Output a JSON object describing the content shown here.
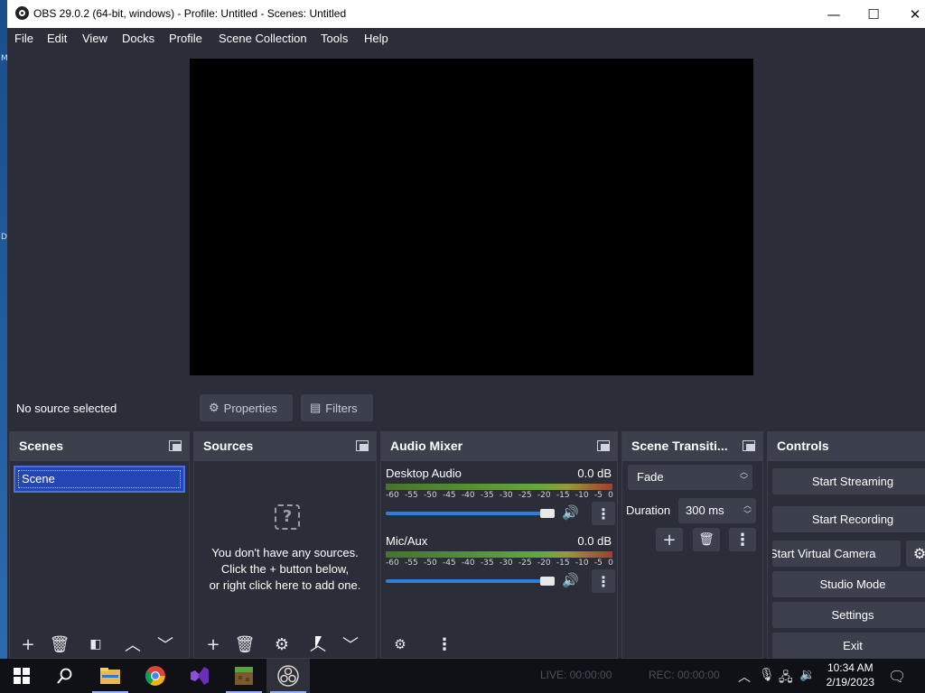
{
  "window": {
    "title": "OBS 29.0.2 (64-bit, windows) - Profile: Untitled - Scenes: Untitled",
    "controls": {
      "minimize": "—",
      "maximize": "☐",
      "close": "✕"
    }
  },
  "desktop_fragments": [
    "M",
    "D"
  ],
  "menu": [
    "File",
    "Edit",
    "View",
    "Docks",
    "Profile",
    "Scene Collection",
    "Tools",
    "Help"
  ],
  "source_toolbar": {
    "status": "No source selected",
    "properties_label": "Properties",
    "filters_label": "Filters"
  },
  "docks": {
    "scenes": {
      "title": "Scenes",
      "items": [
        "Scene"
      ],
      "selected": "Scene"
    },
    "sources": {
      "title": "Sources",
      "empty_line1": "You don't have any sources.",
      "empty_line2": "Click the + button below,",
      "empty_line3": "or right click here to add one."
    },
    "audio_mixer": {
      "title": "Audio Mixer",
      "scale": [
        "-60",
        "-55",
        "-50",
        "-45",
        "-40",
        "-35",
        "-30",
        "-25",
        "-20",
        "-15",
        "-10",
        "-5",
        "0"
      ],
      "channels": [
        {
          "name": "Desktop Audio",
          "db": "0.0 dB",
          "volume": 1.0
        },
        {
          "name": "Mic/Aux",
          "db": "0.0 dB",
          "volume": 1.0
        }
      ]
    },
    "transitions": {
      "title": "Scene Transiti...",
      "selected": "Fade",
      "duration_label": "Duration",
      "duration_value": "300 ms"
    },
    "controls": {
      "title": "Controls",
      "start_streaming": "Start Streaming",
      "start_recording": "Start Recording",
      "start_virtual_camera": "Start Virtual Camera",
      "studio_mode": "Studio Mode",
      "settings": "Settings",
      "exit": "Exit"
    }
  },
  "taskbar": {
    "live": "LIVE: 00:00:00",
    "rec": "REC: 00:00:00",
    "time": "10:34 AM",
    "date": "2/19/2023",
    "apps": [
      "start-icon",
      "search-icon",
      "file-explorer-icon",
      "chrome-icon",
      "visual-studio-icon",
      "minecraft-icon",
      "obs-icon"
    ]
  },
  "colors": {
    "background": "#2b2e38",
    "panel_header": "#3c404d",
    "selection": "#2546b5",
    "accent": "#2f7fd8"
  }
}
